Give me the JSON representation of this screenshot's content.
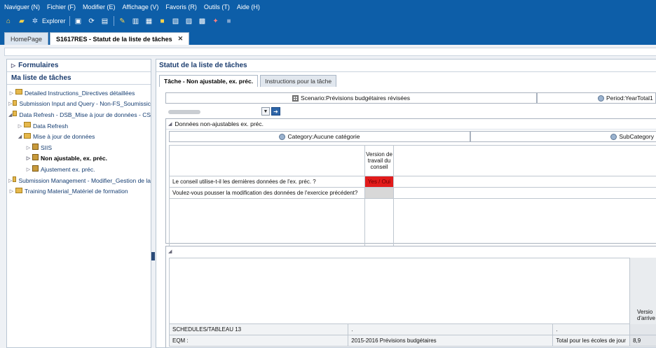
{
  "menu": [
    "Naviguer (N)",
    "Fichier (F)",
    "Modifier (E)",
    "Affichage (V)",
    "Favoris (R)",
    "Outils (T)",
    "Aide (H)"
  ],
  "toolbar": {
    "explorer_label": "Explorer"
  },
  "tabs": {
    "home": "HomePage",
    "current": "S1617RES - Statut de la liste de tâches"
  },
  "left": {
    "formulaires": "Formulaires",
    "tasklist_title": "Ma liste de tâches",
    "items": [
      "Detailed Instructions_Directives détaillées",
      "Submission Input and Query - Non-FS_Soumissic",
      "Data Refresh - DSB_Mise à jour de données - CS",
      "Data Refresh",
      "Mise à jour de données",
      "SIIS",
      "Non ajustable, ex. préc.",
      "Ajustement ex. préc.",
      "Submission Management - Modifier_Gestion de la",
      "Training Material_Matériel de formation"
    ]
  },
  "right": {
    "title": "Statut de la liste de tâches",
    "subtab_active": "Tâche - Non ajustable, ex. préc.",
    "subtab_inactive": "Instructions pour la tâche",
    "pov_scenario": "Scenario:Prévisions budgétaires révisées",
    "pov_period": "Period:YearTotal1",
    "grid_title": "Données non-ajustables ex. préc.",
    "category": "Category:Aucune catégorie",
    "subcategory": "SubCategory",
    "version_header": "Version de travail du conseil",
    "question1": "Le conseil utilise-t-il les dernières données de l'ex. préc. ?",
    "answer1": "Yes / Oui",
    "question2": "Voulez-vous pousser la modification des données de l'exercice précédent?",
    "version_arrivee": "Versio d'arrive",
    "rows": [
      {
        "a": "SCHEDULES/TABLEAU 13",
        "b": ".",
        "c": ".",
        "d": ""
      },
      {
        "a": "EQM :",
        "b": "2015-2016 Prévisions budgétaires",
        "c": "Total pour les écoles de jour",
        "d": "8,9"
      }
    ]
  }
}
